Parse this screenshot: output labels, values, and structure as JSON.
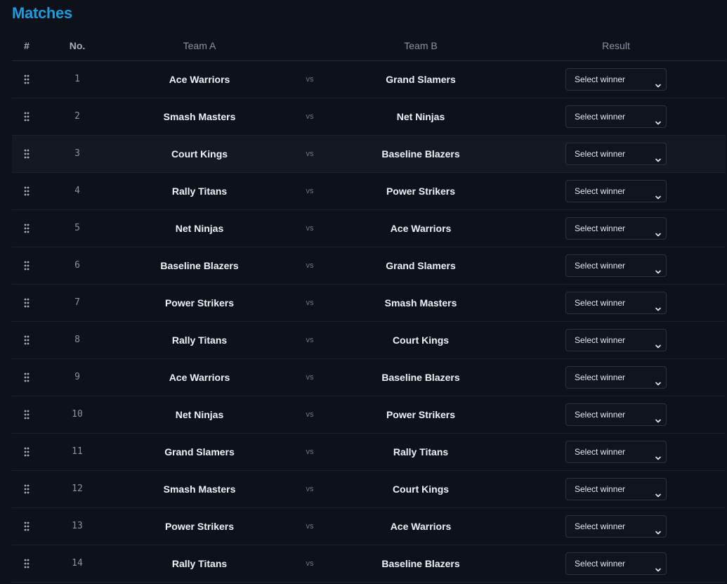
{
  "page": {
    "title": "Matches"
  },
  "table": {
    "headers": {
      "hash": "#",
      "no": "No.",
      "team_a": "Team A",
      "team_b": "Team B",
      "result": "Result"
    },
    "vs_label": "vs",
    "select_placeholder": "Select winner",
    "rows": [
      {
        "no": "1",
        "team_a": "Ace Warriors",
        "team_b": "Grand Slamers"
      },
      {
        "no": "2",
        "team_a": "Smash Masters",
        "team_b": "Net Ninjas"
      },
      {
        "no": "3",
        "team_a": "Court Kings",
        "team_b": "Baseline Blazers"
      },
      {
        "no": "4",
        "team_a": "Rally Titans",
        "team_b": "Power Strikers"
      },
      {
        "no": "5",
        "team_a": "Net Ninjas",
        "team_b": "Ace Warriors"
      },
      {
        "no": "6",
        "team_a": "Baseline Blazers",
        "team_b": "Grand Slamers"
      },
      {
        "no": "7",
        "team_a": "Power Strikers",
        "team_b": "Smash Masters"
      },
      {
        "no": "8",
        "team_a": "Rally Titans",
        "team_b": "Court Kings"
      },
      {
        "no": "9",
        "team_a": "Ace Warriors",
        "team_b": "Baseline Blazers"
      },
      {
        "no": "10",
        "team_a": "Net Ninjas",
        "team_b": "Power Strikers"
      },
      {
        "no": "11",
        "team_a": "Grand Slamers",
        "team_b": "Rally Titans"
      },
      {
        "no": "12",
        "team_a": "Smash Masters",
        "team_b": "Court Kings"
      },
      {
        "no": "13",
        "team_a": "Power Strikers",
        "team_b": "Ace Warriors"
      },
      {
        "no": "14",
        "team_a": "Rally Titans",
        "team_b": "Baseline Blazers"
      }
    ]
  },
  "icons": {
    "drag_handle": "drag-handle-icon",
    "select_arrow": "chevron-down-icon"
  },
  "colors": {
    "background": "#0d111a",
    "title_accent": "#1e9bdc",
    "highlight_row": "#131823"
  }
}
